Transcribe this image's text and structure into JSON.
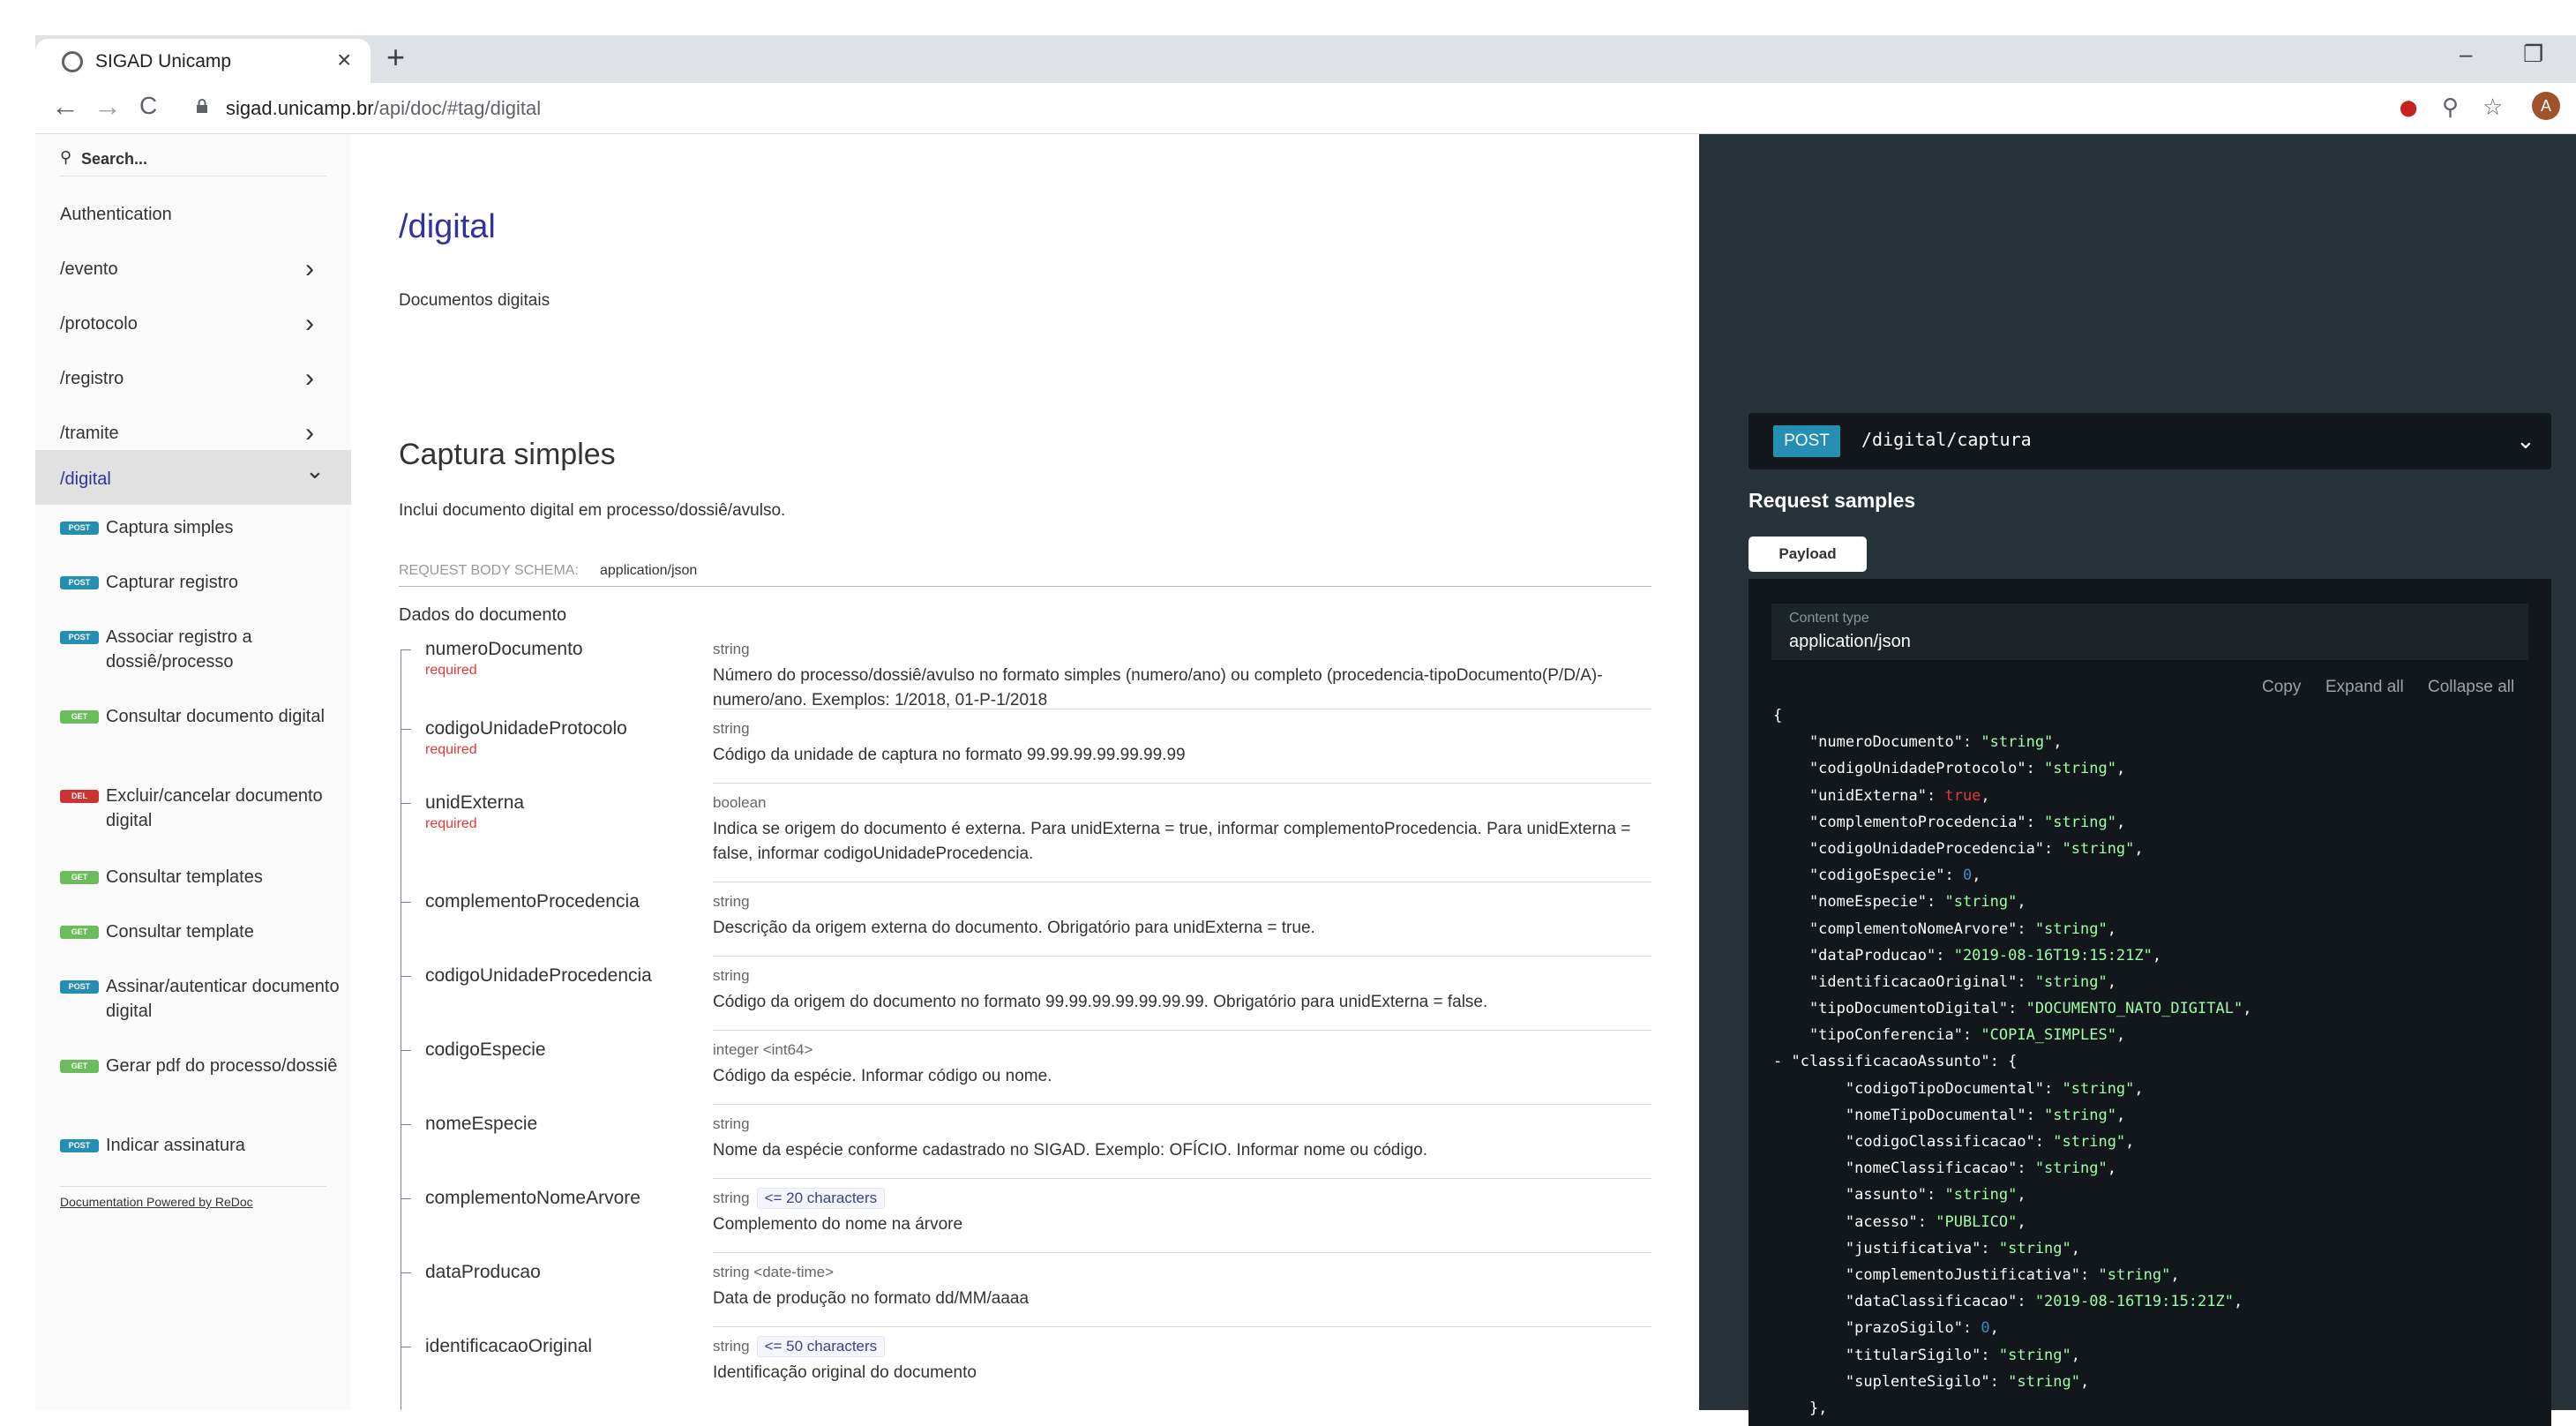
{
  "browser": {
    "tab_title": "SIGAD Unicamp",
    "tab_close": "×",
    "new_tab": "+",
    "url_host": "sigad.unicamp.br",
    "url_path": "/api/doc/#tag/digital",
    "back": "←",
    "forward": "→",
    "reload": "C",
    "minimize": "–",
    "restore": "❐",
    "zoom": "⚲",
    "star": "☆",
    "ext": "⬤",
    "avatar": "A"
  },
  "sidebar": {
    "search_placeholder": "Search...",
    "items": [
      {
        "label": "Authentication",
        "chevron": ""
      },
      {
        "label": "/evento",
        "chevron": "›"
      },
      {
        "label": "/protocolo",
        "chevron": "›"
      },
      {
        "label": "/registro",
        "chevron": "›"
      },
      {
        "label": "/tramite",
        "chevron": "›"
      },
      {
        "label": "/digital",
        "chevron": "⌄"
      }
    ],
    "operations": [
      {
        "method": "POST",
        "label": "Captura simples"
      },
      {
        "method": "POST",
        "label": "Capturar registro"
      },
      {
        "method": "POST",
        "label": "Associar registro a dossiê/processo"
      },
      {
        "method": "GET",
        "label": "Consultar documento digital"
      },
      {
        "method": "DEL",
        "label": "Excluir/cancelar documento digital"
      },
      {
        "method": "GET",
        "label": "Consultar templates"
      },
      {
        "method": "GET",
        "label": "Consultar template"
      },
      {
        "method": "POST",
        "label": "Assinar/autenticar documento digital"
      },
      {
        "method": "GET",
        "label": "Gerar pdf do processo/dossiê"
      },
      {
        "method": "POST",
        "label": "Indicar assinatura"
      }
    ],
    "powered_by": "Documentation Powered by ReDoc"
  },
  "main": {
    "title": "/digital",
    "description": "Documentos digitais",
    "operation_title": "Captura simples",
    "operation_description": "Inclui documento digital em processo/dossiê/avulso.",
    "schema_label": "REQUEST BODY SCHEMA:",
    "schema_value": "application/json",
    "group_label": "Dados do documento",
    "required_label": "required",
    "fields": [
      {
        "name": "numeroDocumento",
        "required": true,
        "type": "string",
        "constraint": "",
        "description": "Número do processo/dossiê/avulso no formato simples (numero/ano) ou completo (procedencia-tipoDocumento(P/D/A)-numero/ano. Exemplos: 1/2018, 01-P-1/2018"
      },
      {
        "name": "codigoUnidadeProtocolo",
        "required": true,
        "type": "string",
        "constraint": "",
        "description": "Código da unidade de captura no formato 99.99.99.99.99.99.99"
      },
      {
        "name": "unidExterna",
        "required": true,
        "type": "boolean",
        "constraint": "",
        "description": "Indica se origem do documento é externa. Para unidExterna = true, informar complementoProcedencia. Para unidExterna = false, informar codigoUnidadeProcedencia."
      },
      {
        "name": "complementoProcedencia",
        "required": false,
        "type": "string",
        "constraint": "",
        "description": "Descrição da origem externa do documento. Obrigatório para unidExterna = true."
      },
      {
        "name": "codigoUnidadeProcedencia",
        "required": false,
        "type": "string",
        "constraint": "",
        "description": "Código da origem do documento no formato 99.99.99.99.99.99.99. Obrigatório para unidExterna = false."
      },
      {
        "name": "codigoEspecie",
        "required": false,
        "type": "integer <int64>",
        "constraint": "",
        "description": "Código da espécie. Informar código ou nome."
      },
      {
        "name": "nomeEspecie",
        "required": false,
        "type": "string",
        "constraint": "",
        "description": "Nome da espécie conforme cadastrado no SIGAD. Exemplo: OFÍCIO. Informar nome ou código."
      },
      {
        "name": "complementoNomeArvore",
        "required": false,
        "type": "string",
        "constraint": "<= 20 characters",
        "description": "Complemento do nome na árvore"
      },
      {
        "name": "dataProducao",
        "required": false,
        "type": "string <date-time>",
        "constraint": "",
        "description": "Data de produção no formato dd/MM/aaaa"
      },
      {
        "name": "identificacaoOriginal",
        "required": false,
        "type": "string",
        "constraint": "<= 50 characters",
        "description": "Identificação original do documento"
      }
    ]
  },
  "right": {
    "method": "POST",
    "path": "/digital/captura",
    "chevron": "⌄",
    "request_samples": "Request samples",
    "payload_tab": "Payload",
    "content_type_label": "Content type",
    "content_type": "application/json",
    "copy": "Copy",
    "expand_all": "Expand all",
    "collapse_all": "Collapse all",
    "code_lines": [
      {
        "indent": 0,
        "prefix": "",
        "key": "{",
        "value": "",
        "vtype": "p"
      },
      {
        "indent": 1,
        "prefix": "",
        "key": "\"numeroDocumento\": ",
        "value": "\"string\"",
        "vtype": "s"
      },
      {
        "indent": 1,
        "prefix": "",
        "key": "\"codigoUnidadeProtocolo\": ",
        "value": "\"string\"",
        "vtype": "s"
      },
      {
        "indent": 1,
        "prefix": "",
        "key": "\"unidExterna\": ",
        "value": "true",
        "vtype": "b"
      },
      {
        "indent": 1,
        "prefix": "",
        "key": "\"complementoProcedencia\": ",
        "value": "\"string\"",
        "vtype": "s"
      },
      {
        "indent": 1,
        "prefix": "",
        "key": "\"codigoUnidadeProcedencia\": ",
        "value": "\"string\"",
        "vtype": "s"
      },
      {
        "indent": 1,
        "prefix": "",
        "key": "\"codigoEspecie\": ",
        "value": "0",
        "vtype": "n"
      },
      {
        "indent": 1,
        "prefix": "",
        "key": "\"nomeEspecie\": ",
        "value": "\"string\"",
        "vtype": "s"
      },
      {
        "indent": 1,
        "prefix": "",
        "key": "\"complementoNomeArvore\": ",
        "value": "\"string\"",
        "vtype": "s"
      },
      {
        "indent": 1,
        "prefix": "",
        "key": "\"dataProducao\": ",
        "value": "\"2019-08-16T19:15:21Z\"",
        "vtype": "s"
      },
      {
        "indent": 1,
        "prefix": "",
        "key": "\"identificacaoOriginal\": ",
        "value": "\"string\"",
        "vtype": "s"
      },
      {
        "indent": 1,
        "prefix": "",
        "key": "\"tipoDocumentoDigital\": ",
        "value": "\"DOCUMENTO_NATO_DIGITAL\"",
        "vtype": "s"
      },
      {
        "indent": 1,
        "prefix": "",
        "key": "\"tipoConferencia\": ",
        "value": "\"COPIA_SIMPLES\"",
        "vtype": "s"
      },
      {
        "indent": 0,
        "prefix": "- ",
        "key": "\"classificacaoAssunto\": {",
        "value": "",
        "vtype": "p"
      },
      {
        "indent": 2,
        "prefix": "",
        "key": "\"codigoTipoDocumental\": ",
        "value": "\"string\"",
        "vtype": "s"
      },
      {
        "indent": 2,
        "prefix": "",
        "key": "\"nomeTipoDocumental\": ",
        "value": "\"string\"",
        "vtype": "s"
      },
      {
        "indent": 2,
        "prefix": "",
        "key": "\"codigoClassificacao\": ",
        "value": "\"string\"",
        "vtype": "s"
      },
      {
        "indent": 2,
        "prefix": "",
        "key": "\"nomeClassificacao\": ",
        "value": "\"string\"",
        "vtype": "s"
      },
      {
        "indent": 2,
        "prefix": "",
        "key": "\"assunto\": ",
        "value": "\"string\"",
        "vtype": "s"
      },
      {
        "indent": 2,
        "prefix": "",
        "key": "\"acesso\": ",
        "value": "\"PUBLICO\"",
        "vtype": "s"
      },
      {
        "indent": 2,
        "prefix": "",
        "key": "\"justificativa\": ",
        "value": "\"string\"",
        "vtype": "s"
      },
      {
        "indent": 2,
        "prefix": "",
        "key": "\"complementoJustificativa\": ",
        "value": "\"string\"",
        "vtype": "s"
      },
      {
        "indent": 2,
        "prefix": "",
        "key": "\"dataClassificacao\": ",
        "value": "\"2019-08-16T19:15:21Z\"",
        "vtype": "s"
      },
      {
        "indent": 2,
        "prefix": "",
        "key": "\"prazoSigilo\": ",
        "value": "0",
        "vtype": "n"
      },
      {
        "indent": 2,
        "prefix": "",
        "key": "\"titularSigilo\": ",
        "value": "\"string\"",
        "vtype": "s"
      },
      {
        "indent": 2,
        "prefix": "",
        "key": "\"suplenteSigilo\": ",
        "value": "\"string\"",
        "vtype": "s"
      },
      {
        "indent": 1,
        "prefix": "",
        "key": "},",
        "value": "",
        "vtype": "p"
      }
    ]
  },
  "colors": {
    "accent": "#32329f",
    "post": "#248fb2",
    "get": "#6bbd5b",
    "delete": "#cc3333",
    "required": "#e53935",
    "panel": "#263238",
    "code_string": "#a0fbaa"
  }
}
